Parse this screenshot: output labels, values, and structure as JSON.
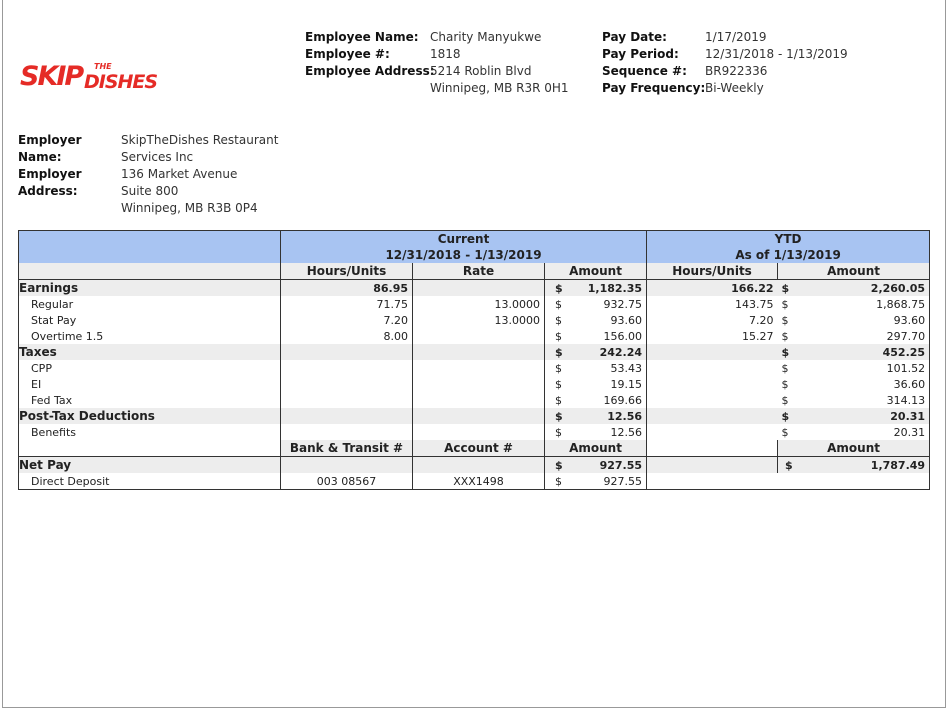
{
  "logo": {
    "skip": "SKIP",
    "the": "THE",
    "dishes": "DISHES"
  },
  "employee": {
    "name_label": "Employee Name:",
    "name": "Charity Manyukwe",
    "number_label": "Employee #:",
    "number": "1818",
    "address_label": "Employee Address:",
    "address1": "5214 Roblin Blvd",
    "address2": "Winnipeg, MB R3R 0H1"
  },
  "pay": {
    "date_label": "Pay Date:",
    "date": "1/17/2019",
    "period_label": "Pay Period:",
    "period": "12/31/2018 - 1/13/2019",
    "sequence_label": "Sequence #:",
    "sequence": "BR922336",
    "frequency_label": "Pay Frequency:",
    "frequency": "Bi-Weekly"
  },
  "employer": {
    "name_label1": "Employer",
    "name_label2": "Name:",
    "name1": "SkipTheDishes Restaurant",
    "name2": "Services Inc",
    "address_label1": "Employer",
    "address_label2": "Address:",
    "address1": "136 Market Avenue",
    "address2": "Suite 800",
    "address3": "Winnipeg, MB R3B 0P4"
  },
  "table": {
    "current_title": "Current",
    "current_range": "12/31/2018 - 1/13/2019",
    "ytd_title": "YTD",
    "ytd_range": "As of 1/13/2019",
    "col_hours": "Hours/Units",
    "col_rate": "Rate",
    "col_amount": "Amount",
    "col_ytd_hours": "Hours/Units",
    "col_ytd_amount": "Amount",
    "currency": "$",
    "earnings": {
      "label": "Earnings",
      "hours": "86.95",
      "amount": "1,182.35",
      "ytd_hours": "166.22",
      "ytd_amount": "2,260.05",
      "rows": [
        {
          "label": "Regular",
          "hours": "71.75",
          "rate": "13.0000",
          "amount": "932.75",
          "ytd_hours": "143.75",
          "ytd_amount": "1,868.75"
        },
        {
          "label": "Stat Pay",
          "hours": "7.20",
          "rate": "13.0000",
          "amount": "93.60",
          "ytd_hours": "7.20",
          "ytd_amount": "93.60"
        },
        {
          "label": "Overtime 1.5",
          "hours": "8.00",
          "rate": "",
          "amount": "156.00",
          "ytd_hours": "15.27",
          "ytd_amount": "297.70"
        }
      ]
    },
    "taxes": {
      "label": "Taxes",
      "amount": "242.24",
      "ytd_amount": "452.25",
      "rows": [
        {
          "label": "CPP",
          "amount": "53.43",
          "ytd_amount": "101.52"
        },
        {
          "label": "EI",
          "amount": "19.15",
          "ytd_amount": "36.60"
        },
        {
          "label": "Fed Tax",
          "amount": "169.66",
          "ytd_amount": "314.13"
        }
      ]
    },
    "deductions": {
      "label": "Post-Tax Deductions",
      "amount": "12.56",
      "ytd_amount": "20.31",
      "rows": [
        {
          "label": "Benefits",
          "amount": "12.56",
          "ytd_amount": "20.31"
        }
      ]
    },
    "col_bank": "Bank & Transit #",
    "col_account": "Account #",
    "col_net_amount": "Amount",
    "col_net_ytd_amount": "Amount",
    "net": {
      "label": "Net Pay",
      "amount": "927.55",
      "ytd_amount": "1,787.49",
      "rows": [
        {
          "label": "Direct Deposit",
          "bank": "003 08567",
          "account": "XXX1498",
          "amount": "927.55"
        }
      ]
    }
  }
}
